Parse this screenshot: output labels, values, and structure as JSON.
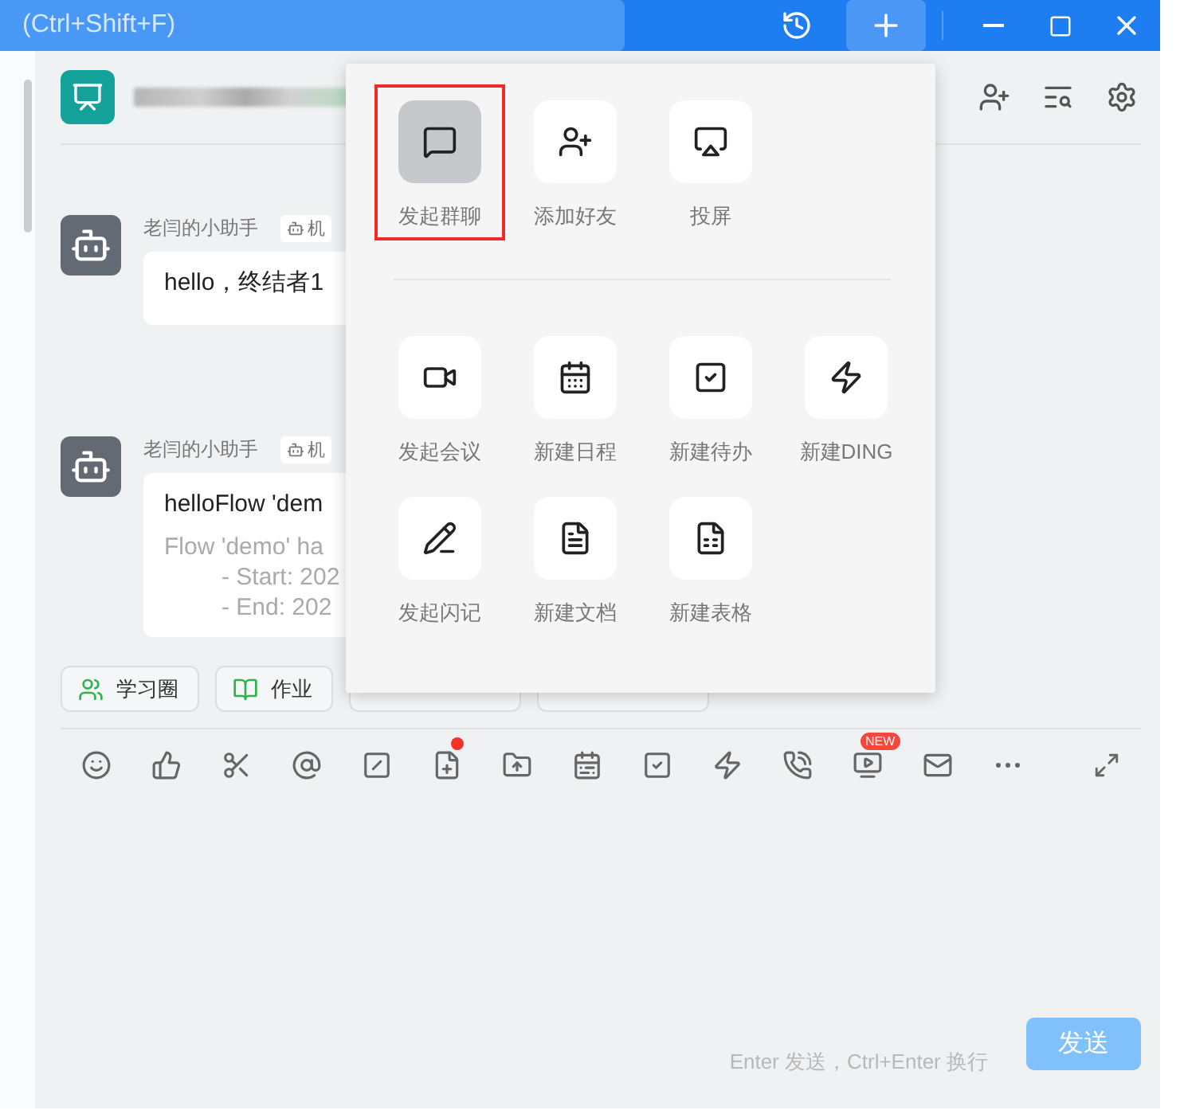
{
  "search": {
    "placeholder": "(Ctrl+Shift+F)"
  },
  "messages": [
    {
      "sender": "老闫的小助手",
      "badge": "机",
      "lines": [
        {
          "kind": "main",
          "text": "hello，终结者1"
        }
      ]
    },
    {
      "sender": "老闫的小助手",
      "badge": "机",
      "lines": [
        {
          "kind": "main",
          "text": "helloFlow 'dem"
        },
        {
          "kind": "muted",
          "text": "Flow 'demo' ha"
        },
        {
          "kind": "indent",
          "text": "- Start: 202"
        },
        {
          "kind": "indent",
          "text": "- End: 202"
        }
      ]
    }
  ],
  "quick_chips": [
    {
      "kind": "label",
      "label": "学习圈",
      "color": "#2fb24c"
    },
    {
      "kind": "label",
      "label": "作业",
      "color": "#2fb24c"
    },
    {
      "kind": "covered"
    },
    {
      "kind": "covered"
    }
  ],
  "toolbar": [
    {
      "kind": "plain"
    },
    {
      "kind": "plain"
    },
    {
      "kind": "plain"
    },
    {
      "kind": "plain"
    },
    {
      "kind": "plain"
    },
    {
      "kind": "dot",
      "notification_dot": true
    },
    {
      "kind": "plain"
    },
    {
      "kind": "plain"
    },
    {
      "kind": "plain"
    },
    {
      "kind": "plain"
    },
    {
      "kind": "plain"
    },
    {
      "kind": "badge",
      "badge": "NEW"
    },
    {
      "kind": "plain"
    },
    {
      "kind": "plain"
    }
  ],
  "input_hint": "Enter 发送，Ctrl+Enter 换行",
  "send_button": {
    "label": "发送",
    "disabled": true
  },
  "popup_menu": {
    "sections": [
      {
        "items": [
          {
            "label": "发起群聊",
            "selected": true
          },
          {
            "label": "添加好友",
            "selected": false
          },
          {
            "label": "投屏",
            "selected": false
          }
        ]
      },
      {
        "items": [
          {
            "label": "发起会议",
            "selected": false
          },
          {
            "label": "新建日程",
            "selected": false
          },
          {
            "label": "新建待办",
            "selected": false
          },
          {
            "label": "新建DING",
            "selected": false
          },
          {
            "label": "发起闪记",
            "selected": false
          },
          {
            "label": "新建文档",
            "selected": false
          },
          {
            "label": "新建表格",
            "selected": false
          }
        ]
      }
    ]
  }
}
